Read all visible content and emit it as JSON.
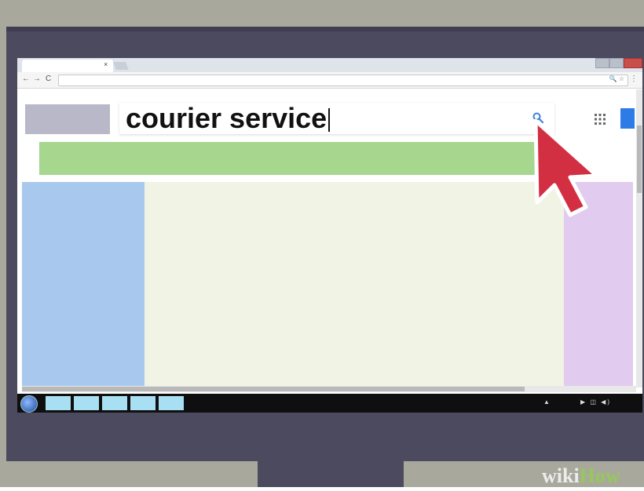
{
  "search": {
    "query": "courier service"
  },
  "browser": {
    "tab_close_glyph": "×",
    "nav_back_glyph": "←",
    "nav_forward_glyph": "→",
    "nav_reload_glyph": "C",
    "url_icons": "🔍 ☆",
    "menu_glyph": "⋮"
  },
  "taskbar": {
    "tray_arrow": "▲",
    "tray_icons": "▶ ◫ ◀)"
  },
  "watermark": {
    "wiki": "wiki",
    "how": "How"
  },
  "colors": {
    "accent_blue": "#2d7be6",
    "pointer_red": "#d32f43",
    "green_bar": "#a7d68f",
    "left_col": "#a8c9ed",
    "right_col": "#e1cbef"
  }
}
